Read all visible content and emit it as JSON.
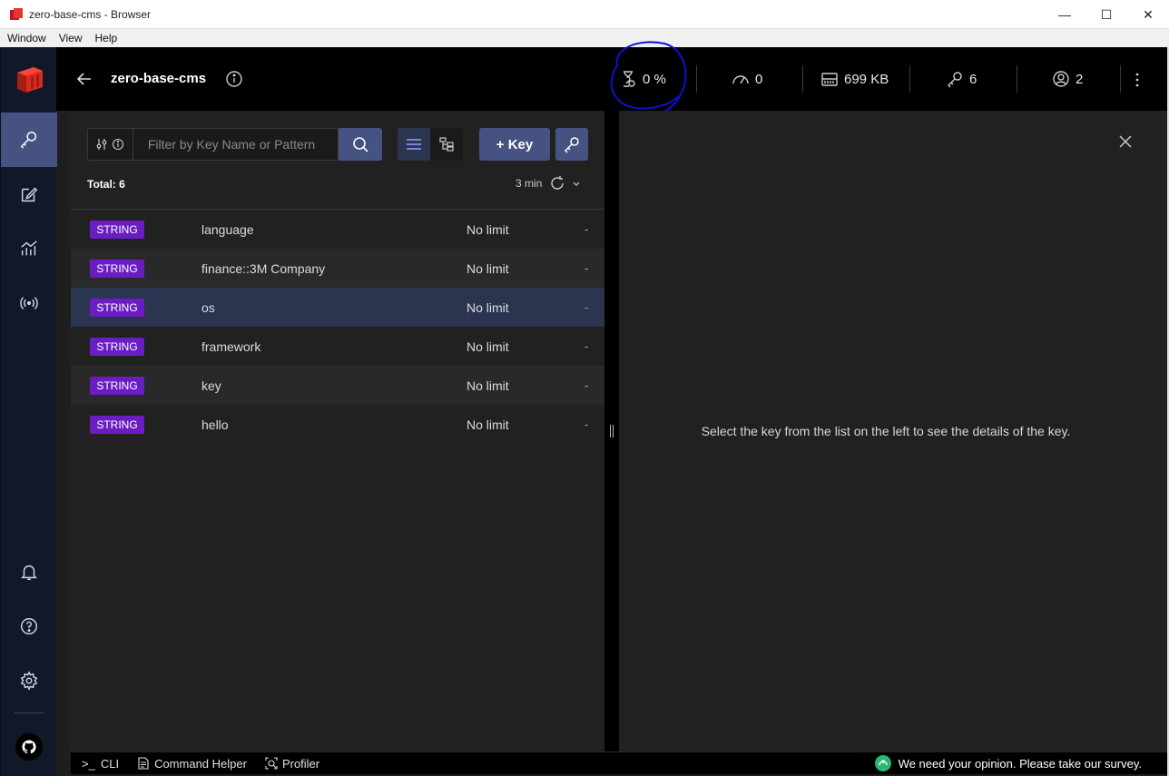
{
  "window": {
    "title": "zero-base-cms - Browser",
    "minimize": "—",
    "maximize": "☐",
    "close": "✕"
  },
  "menu": [
    "Window",
    "View",
    "Help"
  ],
  "header": {
    "db_name": "zero-base-cms",
    "stats": {
      "cpu": "0 %",
      "ops": "0",
      "memory": "699 KB",
      "keys": "6",
      "clients": "2"
    }
  },
  "browser": {
    "filter_placeholder": "Filter by Key Name or Pattern",
    "add_key_label": "+ Key",
    "total_label": "Total: 6",
    "refresh_label": "3 min",
    "keys": [
      {
        "type": "STRING",
        "name": "language",
        "ttl": "No limit",
        "size": "-"
      },
      {
        "type": "STRING",
        "name": "finance::3M Company",
        "ttl": "No limit",
        "size": "-"
      },
      {
        "type": "STRING",
        "name": "os",
        "ttl": "No limit",
        "size": "-"
      },
      {
        "type": "STRING",
        "name": "framework",
        "ttl": "No limit",
        "size": "-"
      },
      {
        "type": "STRING",
        "name": "key",
        "ttl": "No limit",
        "size": "-"
      },
      {
        "type": "STRING",
        "name": "hello",
        "ttl": "No limit",
        "size": "-"
      }
    ],
    "selected_index": 2
  },
  "details": {
    "empty_message": "Select the key from the list on the left to see the details of the key."
  },
  "bottom": {
    "cli": "CLI",
    "cli_prompt": ">_",
    "command_helper": "Command Helper",
    "profiler": "Profiler",
    "survey": "We need your opinion. Please take our survey."
  },
  "colors": {
    "accent": "#465282",
    "badge_string": "#6a1dc3",
    "sidebar": "#111827",
    "annotation": "#1010d0"
  }
}
